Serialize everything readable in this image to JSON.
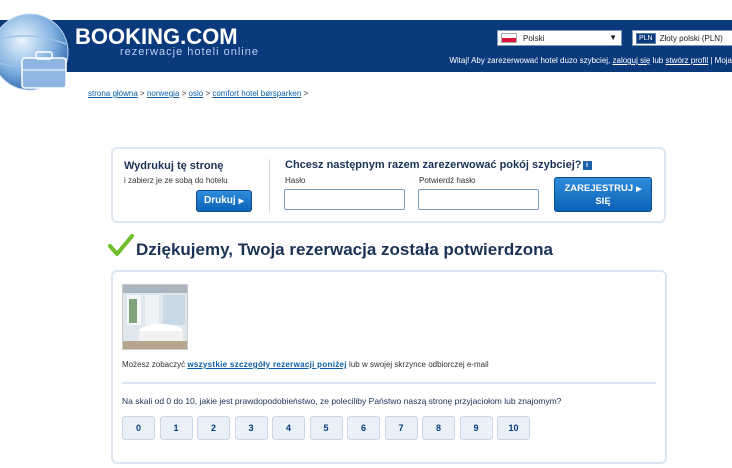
{
  "header": {
    "logo_main": "BOOKING",
    "logo_suffix": ".COM",
    "tagline": "rezerwacje hoteli online",
    "language": "Polski",
    "currency_code": "PLN",
    "currency_name": "Złoty polski (PLN)",
    "welcome_text": "Witaj! Aby zarezerwować hotel duzo szybciej, ",
    "login_link": "zaloguj się",
    "or_text": " lub ",
    "create_profile_link": "stwórz profil",
    "separator": " | ",
    "my_link": "Moja",
    "colors": {
      "brand": "#0b3a7c",
      "accent": "#0b61b6",
      "check": "#6fbf2a"
    }
  },
  "breadcrumb": {
    "items": [
      "strona główna",
      "norwegia",
      "oslo",
      "comfort hotel børsparken"
    ],
    "separator": " > "
  },
  "print_box": {
    "title": "Wydrukuj tę stronę",
    "subtitle": "i zabierz je ze sobą do hotelu",
    "button": "Drukuj",
    "arrow_icon": "arrow-right-icon"
  },
  "register_box": {
    "title": "Chcesz następnym razem zarezerwować pokój szybciej?",
    "info_icon": "i",
    "password_label": "Hasło",
    "confirm_label": "Potwierdź hasło",
    "button_line1": "ZAREJESTRUJ",
    "button_line2": "SIĘ"
  },
  "confirmation": {
    "heading": "Dziękujemy, Twoja rezerwacja została potwierdzona"
  },
  "main": {
    "details_prefix": "Możesz zobaczyć ",
    "details_link": "wszystkie szczegóły rezerwacji poniżej",
    "details_suffix": " lub w swojej skrzynce odbiorczej e-mail",
    "nps_question": "Na skali od 0 do 10, jakie jest prawdopodobieństwo, ze poleciliby Państwo naszą stronę przyjaciołom lub znajomym?",
    "nps_options": [
      "0",
      "1",
      "2",
      "3",
      "4",
      "5",
      "6",
      "7",
      "8",
      "9",
      "10"
    ]
  }
}
